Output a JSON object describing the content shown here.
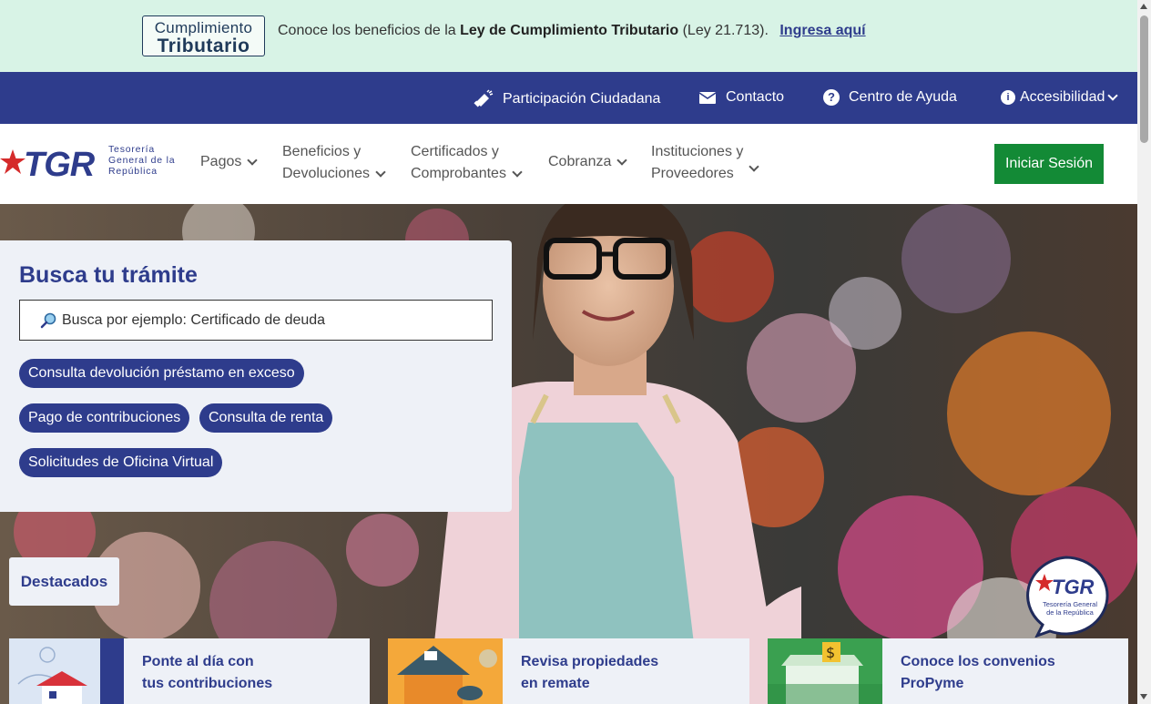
{
  "announcement": {
    "logo_line1": "Cumplimiento",
    "logo_line2": "Tributario",
    "text_prefix": "Conoce los beneficios de la ",
    "text_bold": "Ley de Cumplimiento Tributario",
    "text_suffix": " (Ley 21.713).",
    "link": "Ingresa aquí"
  },
  "utility_nav": {
    "participacion": "Participación Ciudadana",
    "contacto": "Contacto",
    "ayuda": "Centro de Ayuda",
    "accesibilidad": "Accesibilidad"
  },
  "logo": {
    "acronym": "TGR",
    "line1": "Tesorería",
    "line2": "General de la",
    "line3": "República"
  },
  "main_nav": {
    "pagos": "Pagos",
    "beneficios_1": "Beneficios y",
    "beneficios_2": "Devoluciones",
    "certificados_1": "Certificados y",
    "certificados_2": "Comprobantes",
    "cobranza": "Cobranza",
    "instituciones_1": "Instituciones y",
    "instituciones_2": "Proveedores",
    "login": "Iniciar Sesión"
  },
  "search": {
    "title": "Busca tu trámite",
    "placeholder": "Busca por ejemplo: Certificado de deuda",
    "chips": [
      "Consulta devolución préstamo en exceso",
      "Pago de contribuciones",
      "Consulta de renta",
      "Solicitudes de Oficina Virtual"
    ]
  },
  "destacados": "Destacados",
  "chat_badge": {
    "acronym": "TGR",
    "line1": "Tesorería General",
    "line2": "de la República"
  },
  "cards": [
    {
      "line1": "Ponte al día con",
      "line2": "tus contribuciones"
    },
    {
      "line1": "Revisa propiedades",
      "line2": "en remate"
    },
    {
      "line1": "Conoce los convenios",
      "line2": "ProPyme"
    }
  ],
  "colors": {
    "brand_blue": "#2e3c8c",
    "login_green": "#138a36",
    "announce_bg": "#d8f3e6",
    "panel_bg": "#eef1f7"
  }
}
